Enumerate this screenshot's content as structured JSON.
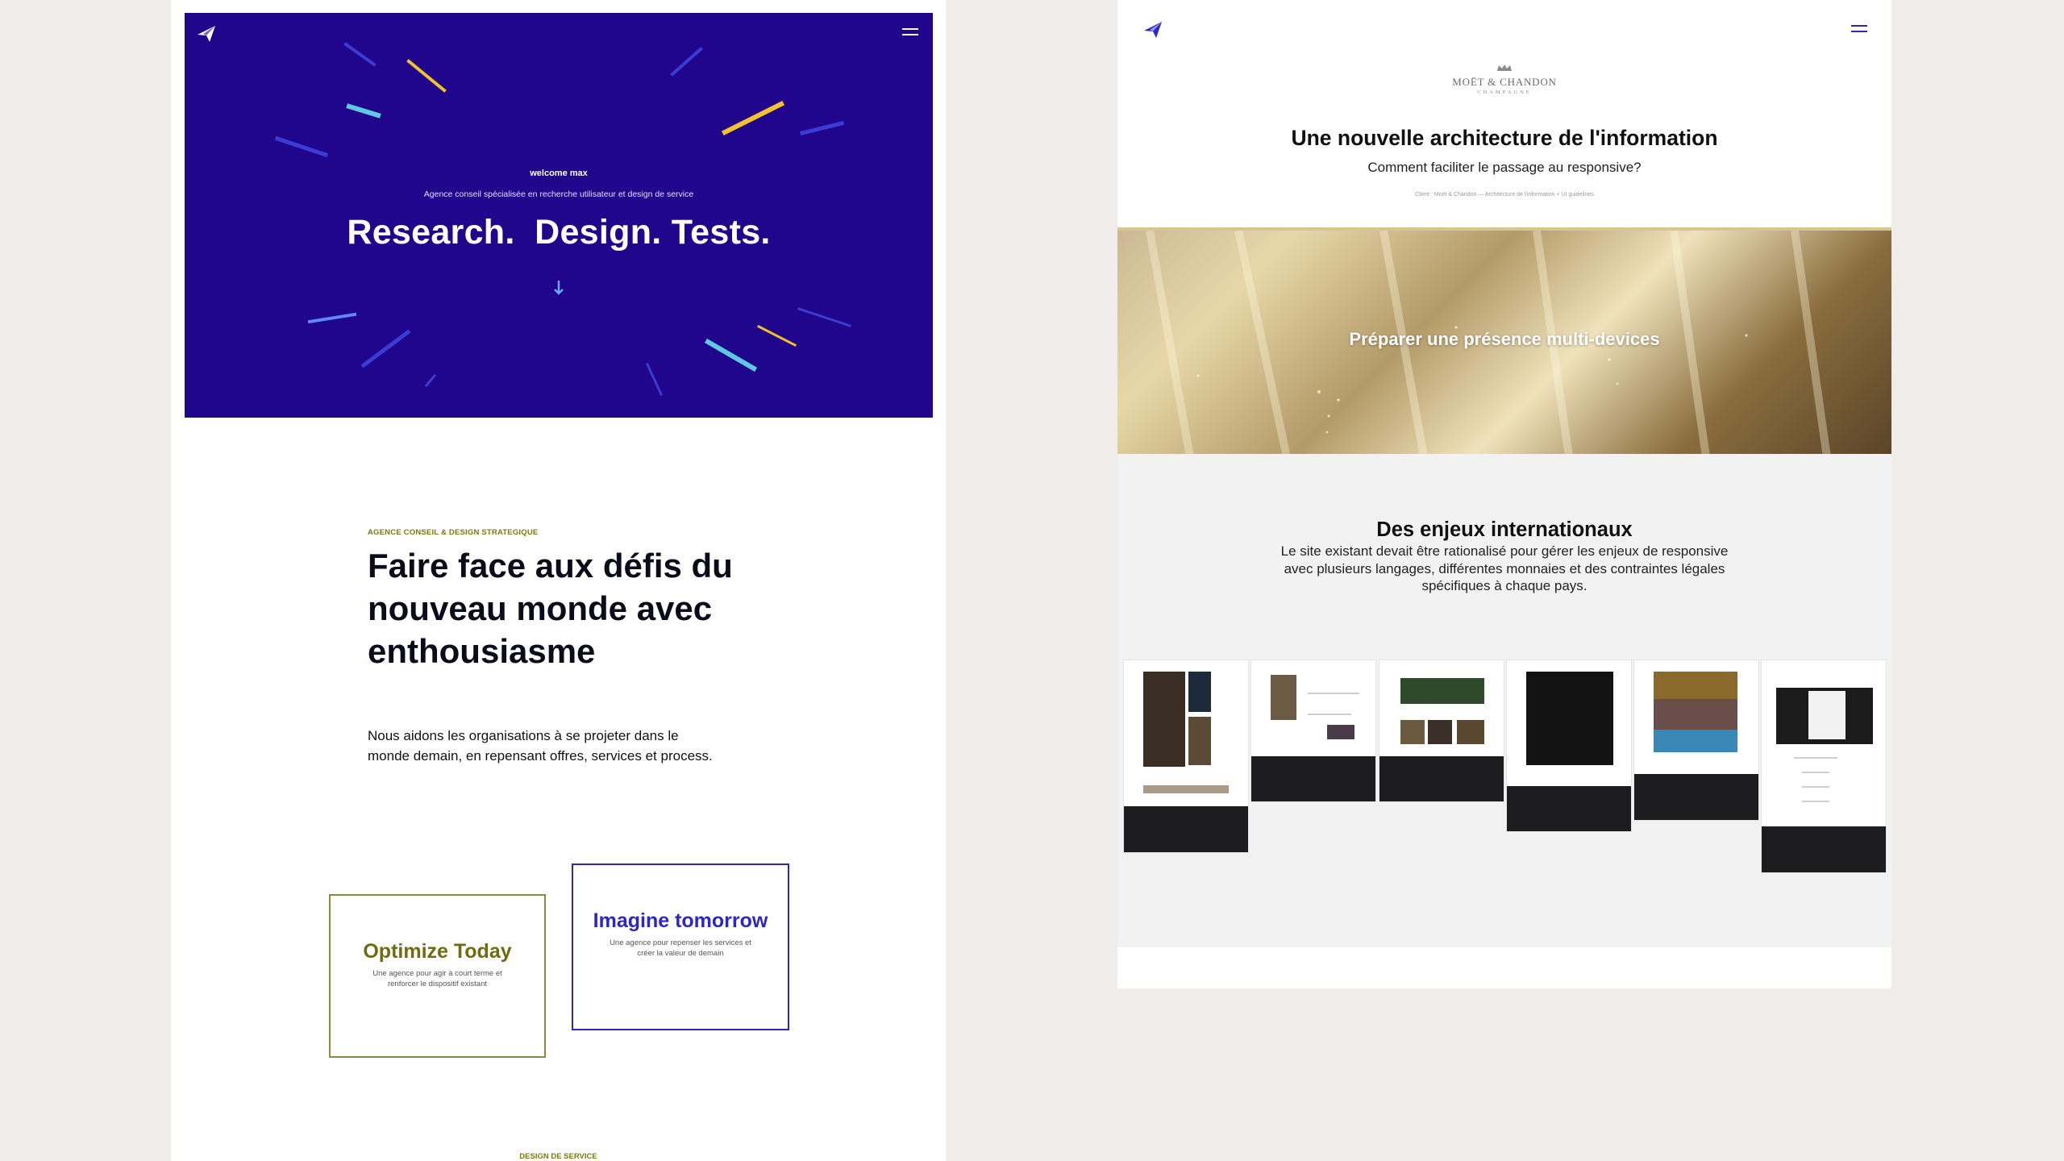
{
  "left": {
    "hero": {
      "eyebrow": "welcome max",
      "subtitle": "Agence conseil spécialisée en recherche utilisateur et design de service",
      "title": "Research.  Design. Tests.",
      "bg_color": "#1f068c"
    },
    "intro": {
      "eyebrow": "AGENCE CONSEIL & DESIGN STRATEGIQUE",
      "heading": "Faire face aux défis du nouveau monde avec enthousiasme",
      "body": "Nous aidons les organisations à se projeter dans le monde demain, en repensant offres, services et process."
    },
    "cards": [
      {
        "title": "Optimize Today",
        "text": "Une agence pour agir à court terme et renforcer le dispositif existant",
        "color": "#6e6b10"
      },
      {
        "title": "Imagine tomorrow",
        "text": "Une agence pour repenser les services et créer la valeur de demain",
        "color": "#2b27c6"
      }
    ],
    "footer_eyebrow": "DESIGN DE SERVICE"
  },
  "right": {
    "brand": {
      "name": "MOËT & CHANDON",
      "sub": "CHAMPAGNE"
    },
    "title": "Une nouvelle architecture de l'information",
    "subtitle": "Comment faciliter le passage au responsive?",
    "breadcrumb": "Client : Moët & Chandon   —   Architecture de l'information + UI guidelines",
    "band_text": "Préparer une présence multi-devices",
    "section_title": "Des enjeux internationaux",
    "section_body": "Le site existant devait être rationalisé pour gérer les enjeux de responsive avec plusieurs langages, différentes monnaies et des contraintes légales spécifiques à chaque pays.",
    "accent_color": "#2d26c2"
  },
  "icons": {
    "logo": "paper-plane-logo-icon",
    "menu": "hamburger-menu-icon",
    "scroll": "arrow-down-icon"
  }
}
